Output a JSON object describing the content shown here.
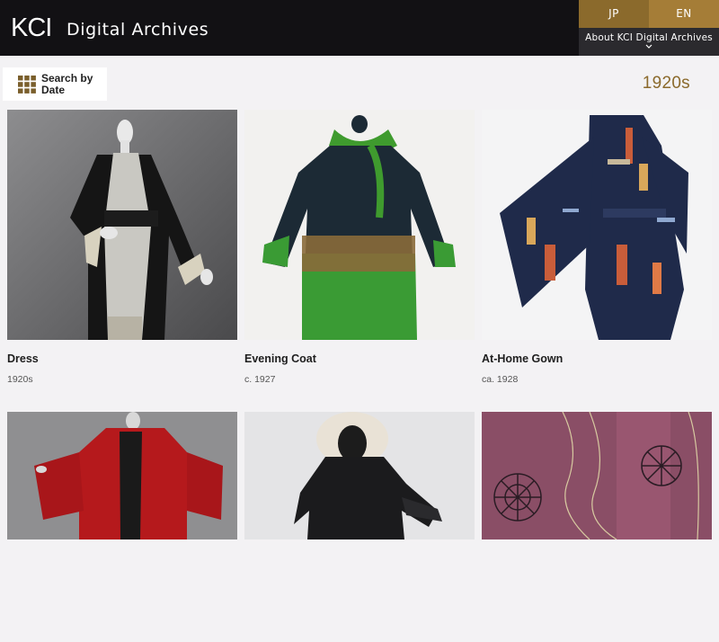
{
  "header": {
    "logo_text": "KCI",
    "title": "Digital Archives",
    "lang_jp": "JP",
    "lang_en": "EN",
    "about_label": "About KCI Digital Archives",
    "about_icon": "chevron-down-icon"
  },
  "toolbar": {
    "search_by_date_label": "Search by Date",
    "search_icon": "grid-icon",
    "current_decade": "1920s"
  },
  "items": [
    {
      "title": "Dress",
      "date": "1920s"
    },
    {
      "title": "Evening Coat",
      "date": "c. 1927"
    },
    {
      "title": "At-Home Gown",
      "date": "ca. 1928"
    },
    {
      "title": "",
      "date": ""
    },
    {
      "title": "",
      "date": ""
    },
    {
      "title": "",
      "date": ""
    }
  ],
  "colors": {
    "header_bg": "#121114",
    "accent_gold": "#8b6a2c",
    "accent_gold_light": "#a57d37",
    "page_bg": "#f3f2f4"
  }
}
